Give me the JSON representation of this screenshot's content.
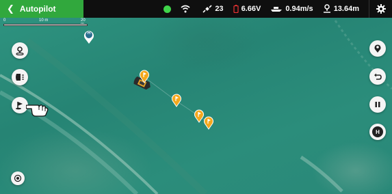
{
  "header": {
    "back_label": "Autopilot",
    "status": {
      "connection": "connected",
      "satellites": "23",
      "battery_voltage": "6.66V",
      "speed": "0.94m/s",
      "distance": "13.64m"
    }
  },
  "scale_bar": {
    "start": "0",
    "mid": "10 m",
    "end": "20 m"
  },
  "home_marker": {
    "label": "H"
  },
  "right_controls": {
    "home_button_label": "H"
  },
  "waypoints": [
    {
      "label": "1"
    },
    {
      "label": "2"
    },
    {
      "label": "3"
    },
    {
      "label": "4"
    }
  ],
  "colors": {
    "accent_green": "#31a83d",
    "waypoint_orange": "#f4a81d",
    "status_dot": "#3fd44a"
  }
}
